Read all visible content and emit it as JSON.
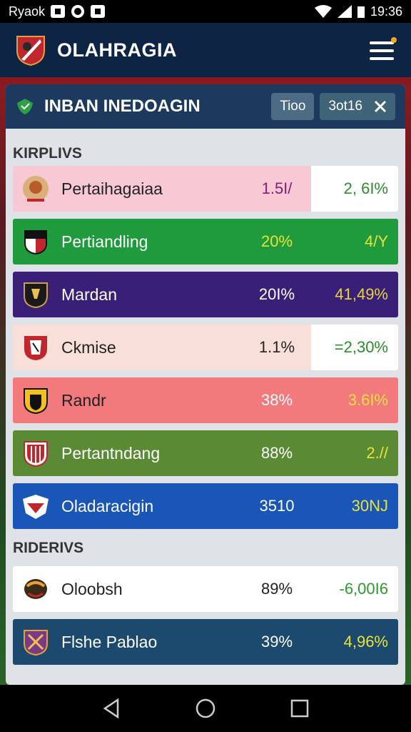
{
  "status": {
    "left_text": "Ryaok",
    "time": "19:36"
  },
  "app": {
    "title": "OLAHRAGIA"
  },
  "panel": {
    "title": "INBAN INEDOAGIN",
    "chip1": "Tioo",
    "chip2": "3ot16"
  },
  "sections": [
    "KIRPLIVS",
    "RIDERIVS"
  ],
  "rows1": [
    {
      "name": "Pertaihagaiaa",
      "value": "1.5I/",
      "percent": "2, 6I%"
    },
    {
      "name": "Pertiandling",
      "value": "20%",
      "percent": "4/Y"
    },
    {
      "name": "Mardan",
      "value": "20I%",
      "percent": "41,49%"
    },
    {
      "name": "Ckmise",
      "value": "1.1%",
      "percent": "=2,30%"
    },
    {
      "name": "Randr",
      "value": "38%",
      "percent": "3.6I%"
    },
    {
      "name": "Pertantndang",
      "value": "88%",
      "percent": "2.//"
    },
    {
      "name": "Oladaracigin",
      "value": "3510",
      "percent": "30NJ"
    }
  ],
  "rows2": [
    {
      "name": "Oloobsh",
      "value": "89%",
      "percent": "-6,00I6"
    },
    {
      "name": "Flshe Pablao",
      "value": "39%",
      "percent": "4,96%"
    }
  ],
  "colors": {
    "accent": "#1b3a5e",
    "header": "#0e2444"
  }
}
